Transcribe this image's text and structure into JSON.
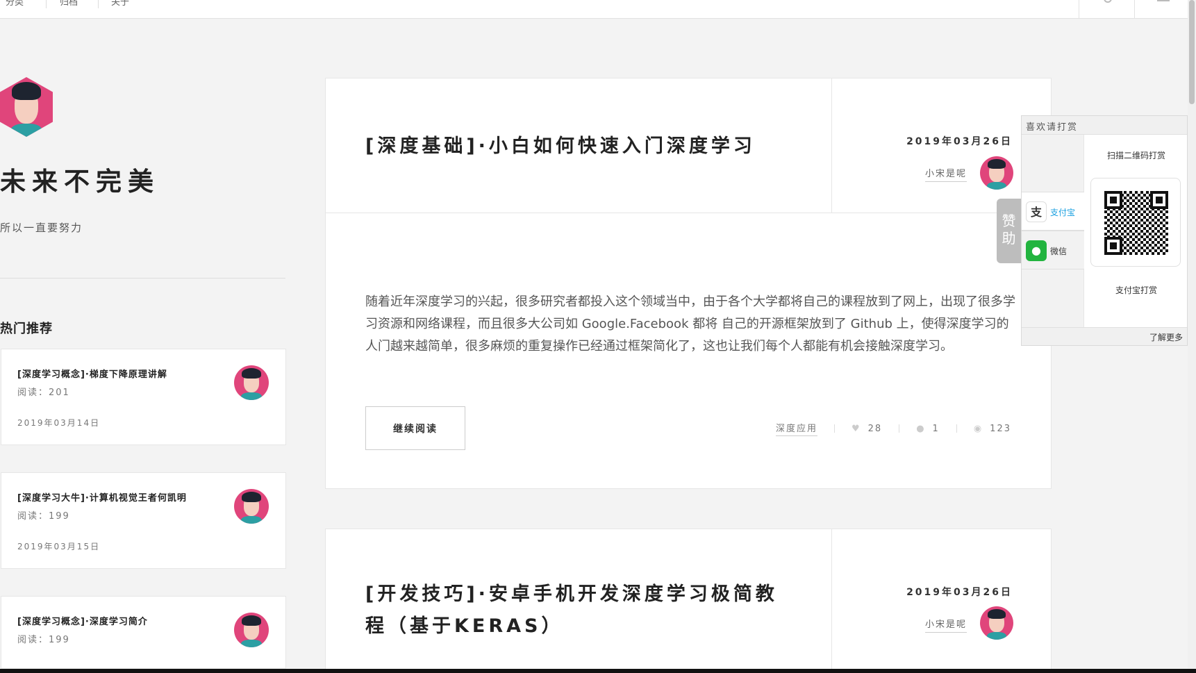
{
  "nav": {
    "items": [
      "分类",
      "归档",
      "关于"
    ]
  },
  "profile": {
    "title": "未来不完美",
    "subtitle": "所以一直要努力"
  },
  "hot": {
    "heading": "热门推荐",
    "items": [
      {
        "title": "[深度学习概念]·梯度下降原理讲解",
        "reads": "阅读：201",
        "date": "2019年03月14日"
      },
      {
        "title": "[深度学习大牛]·计算机视觉王者何凯明",
        "reads": "阅读：199",
        "date": "2019年03月15日"
      },
      {
        "title": "[深度学习概念]·深度学习简介",
        "reads": "阅读：199",
        "date": ""
      }
    ]
  },
  "posts": [
    {
      "title": "[深度基础]·小白如何快速入门深度学习",
      "date": "2019年03月26日",
      "author": "小宋是呢",
      "excerpt": "随着近年深度学习的兴起，很多研究者都投入这个领域当中，由于各个大学都将自己的课程放到了网上，出现了很多学习资源和网络课程，而且很多大公司如 Google.Facebook 都将 自己的开源框架放到了 Github 上，使得深度学习的人门越来越简单，很多麻烦的重复操作已经通过框架简化了，这也让我们每个人都能有机会接触深度学习。",
      "read_more": "继续阅读",
      "category": "深度应用",
      "likes": "28",
      "comments": "1",
      "views": "123"
    },
    {
      "title": "[开发技巧]·安卓手机开发深度学习极简教程（基于KERAS）",
      "date": "2019年03月26日",
      "author": "小宋是呢"
    }
  ],
  "donate": {
    "header": "喜欢请打赏",
    "tab": "赞助",
    "methods": [
      {
        "label": "支付宝",
        "icon": "alipay-icon",
        "color": "#1aa0e0"
      },
      {
        "label": "微信",
        "icon": "wechat-icon",
        "color": "#22b43f"
      }
    ],
    "scan_text": "扫描二维码打赏",
    "pay_label": "支付宝打赏",
    "more": "了解更多"
  },
  "colors": {
    "accent": "#e0457b",
    "alipay_link": "#1aa0e0"
  }
}
